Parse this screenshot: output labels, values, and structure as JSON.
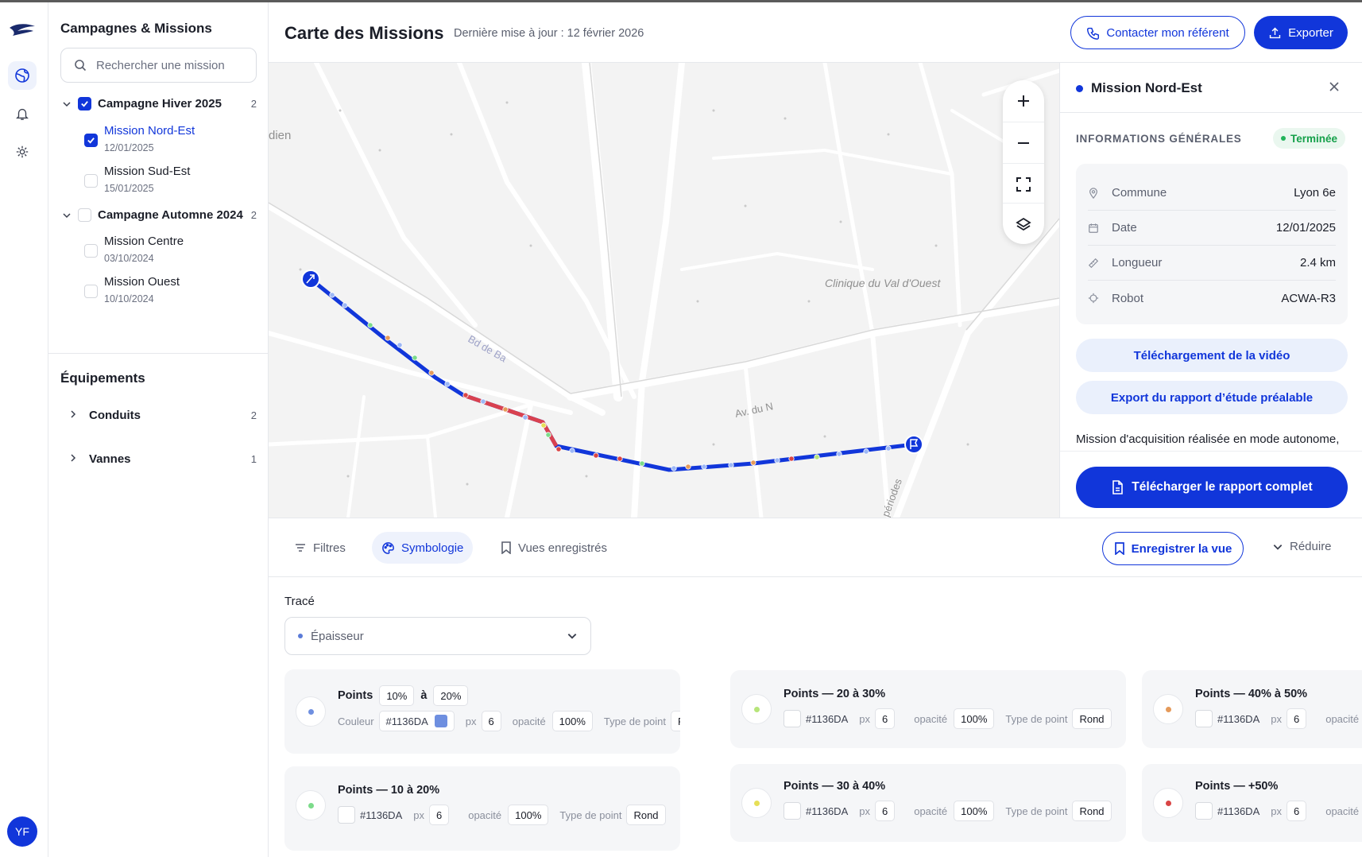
{
  "sidebar": {
    "title": "Campagnes & Missions",
    "search_placeholder": "Rechercher une mission",
    "campaigns": [
      {
        "name": "Campagne Hiver 2025",
        "count": "2",
        "checked": true,
        "missions": [
          {
            "name": "Mission Nord-Est",
            "date": "12/01/2025",
            "checked": true,
            "selected": true
          },
          {
            "name": "Mission Sud-Est",
            "date": "15/01/2025",
            "checked": false
          }
        ]
      },
      {
        "name": "Campagne Automne 2024",
        "count": "2",
        "checked": false,
        "missions": [
          {
            "name": "Mission Centre",
            "date": "03/10/2024",
            "checked": false
          },
          {
            "name": "Mission Ouest",
            "date": "10/10/2024",
            "checked": false
          }
        ]
      }
    ],
    "equipment_title": "Équipements",
    "equipment": [
      {
        "name": "Conduits",
        "count": "2"
      },
      {
        "name": "Vannes",
        "count": "1"
      }
    ]
  },
  "user": {
    "initials": "YF"
  },
  "header": {
    "title": "Carte des Missions",
    "updated": "Dernière mise à jour : 12 février 2026",
    "contact_label": "Contacter mon référent",
    "export_label": "Exporter"
  },
  "map": {
    "labels": [
      "dien",
      "Clinique du Val d'Ouest",
      "Av. du N",
      "Bd de Ba",
      "périodes"
    ]
  },
  "detail": {
    "title": "Mission Nord-Est",
    "section": "INFORMATIONS GÉNÉRALES",
    "status": "Terminée",
    "rows": [
      {
        "icon": "pin-icon",
        "label": "Commune",
        "value": "Lyon 6e"
      },
      {
        "icon": "calendar-icon",
        "label": "Date",
        "value": "12/01/2025"
      },
      {
        "icon": "ruler-icon",
        "label": "Longueur",
        "value": "2.4 km"
      },
      {
        "icon": "robot-icon",
        "label": "Robot",
        "value": "ACWA-R3"
      }
    ],
    "video_btn": "Téléchargement de la vidéo",
    "report_btn": "Export du rapport d’étude préalable",
    "description": "Mission d'acquisition réalisée en mode autonome,",
    "download_btn": "Télécharger le rapport complet"
  },
  "bottom": {
    "tabs": [
      "Filtres",
      "Symbologie",
      "Vues enregistrés"
    ],
    "save_view": "Enregistrer la vue",
    "reduce": "Réduire",
    "trace_label": "Tracé",
    "select_value": "Épaisseur",
    "labels": {
      "couleur": "Couleur",
      "px": "px",
      "opacite": "opacité",
      "type": "Type de point"
    },
    "card_first": {
      "title": "Points",
      "from": "10%",
      "sep": "à",
      "to": "20%",
      "hex": "#1136DA",
      "px": "6",
      "opacity": "100%",
      "type": "Rond",
      "color": "#6E8FE0"
    },
    "cards": [
      {
        "title": "Points — 10 à 20%",
        "hex": "#1136DA",
        "px": "6",
        "opacity": "100%",
        "type": "Rond",
        "color": "#7CDB8A"
      },
      {
        "title": "Points — 20 à 30%",
        "hex": "#1136DA",
        "px": "6",
        "opacity": "100%",
        "type": "Rond",
        "color": "#B7E57A"
      },
      {
        "title": "Points — 30 à 40%",
        "hex": "#1136DA",
        "px": "6",
        "opacity": "100%",
        "type": "Rond",
        "color": "#E6DF57"
      },
      {
        "title": "Points — 40% à 50%",
        "hex": "#1136DA",
        "px": "6",
        "opacity": "opacité",
        "type": "",
        "color": "#E59A5A"
      },
      {
        "title": "Points — +50%",
        "hex": "#1136DA",
        "px": "6",
        "opacity": "opacité",
        "type": "",
        "color": "#D94545"
      }
    ]
  },
  "colors": {
    "accent": "#1136DA",
    "success": "#15A04A",
    "track_alert": "#D9414F"
  }
}
